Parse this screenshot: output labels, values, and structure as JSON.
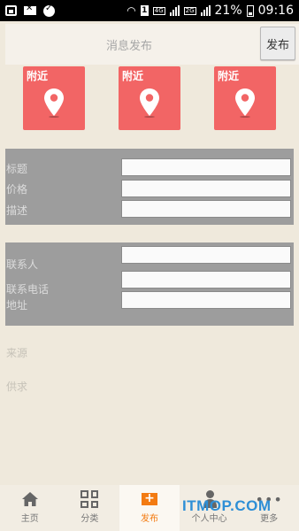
{
  "status_bar": {
    "network_type": "4G",
    "network_type_2": "2G",
    "battery": "21%",
    "time": "09:16",
    "sim": "1"
  },
  "header": {
    "title": "消息发布",
    "publish_button": "发布"
  },
  "location_cards": [
    {
      "label": "附近",
      "icon": "location-pin-icon"
    },
    {
      "label": "附近",
      "icon": "location-pin-icon"
    },
    {
      "label": "附近",
      "icon": "location-pin-icon"
    }
  ],
  "form1": {
    "title_label": "标题",
    "title_value": "",
    "price_label": "价格",
    "price_value": "",
    "desc_label": "描述",
    "desc_value": ""
  },
  "form2": {
    "contact_label": "联系人",
    "contact_value": "",
    "phone_label": "联系电话",
    "phone_value": "",
    "address_label": "地址",
    "address_value": ""
  },
  "source_label": "来源",
  "supply_label": "供求",
  "bottom_nav": [
    {
      "label": "主页",
      "icon": "house-icon",
      "active": false
    },
    {
      "label": "分类",
      "icon": "grid-icon",
      "active": false
    },
    {
      "label": "发布",
      "icon": "plus-icon",
      "active": true
    },
    {
      "label": "个人中心",
      "icon": "person-icon",
      "active": false
    },
    {
      "label": "更多",
      "icon": "more-icon",
      "active": false
    }
  ],
  "watermark": "ITMOP.COM",
  "colors": {
    "card_red": "#f26565",
    "accent_orange": "#f37b12",
    "form_gray": "#9d9d9d",
    "background": "#efe9dc"
  }
}
